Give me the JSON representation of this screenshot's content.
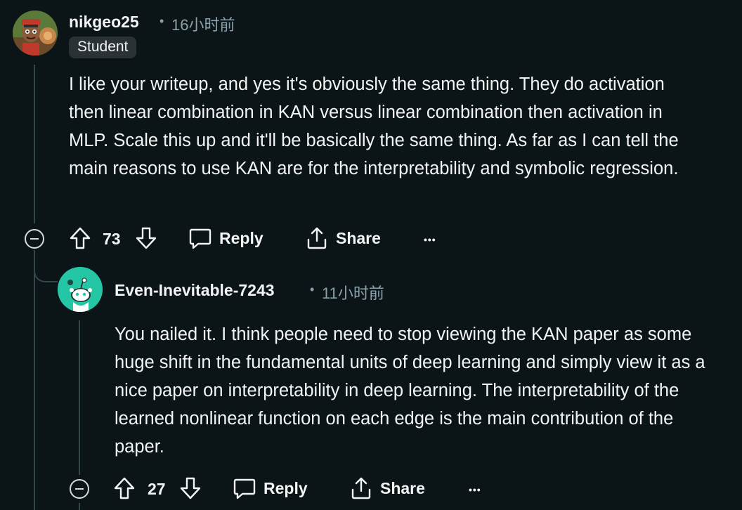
{
  "comment1": {
    "username": "nikgeo25",
    "timestamp": "16小时前",
    "flair": "Student",
    "body": "I like your writeup, and yes it's obviously the same thing. They do activation then linear combination in KAN versus linear combination then activation in MLP. Scale this up and it'll be basically the same thing. As far as I can tell the main reasons to use KAN are for the interpretability and symbolic regression.",
    "votes": "73",
    "reply_label": "Reply",
    "share_label": "Share",
    "more_label": "•••"
  },
  "comment2": {
    "username": "Even-Inevitable-7243",
    "timestamp": "11小时前",
    "body": "You nailed it. I think people need to stop viewing the KAN paper as some huge shift in the fundamental units of deep learning and simply view it as a nice paper on interpretability in deep learning. The interpretability of the learned nonlinear function on each edge is the main contribution of the paper.",
    "votes": "27",
    "reply_label": "Reply",
    "share_label": "Share",
    "more_label": "•••"
  },
  "colors": {
    "background": "#0b1416",
    "text": "#f2f4f5",
    "muted": "#8ba2ad",
    "thread_line": "#33464c",
    "avatar2_bg": "#24c6a6"
  }
}
